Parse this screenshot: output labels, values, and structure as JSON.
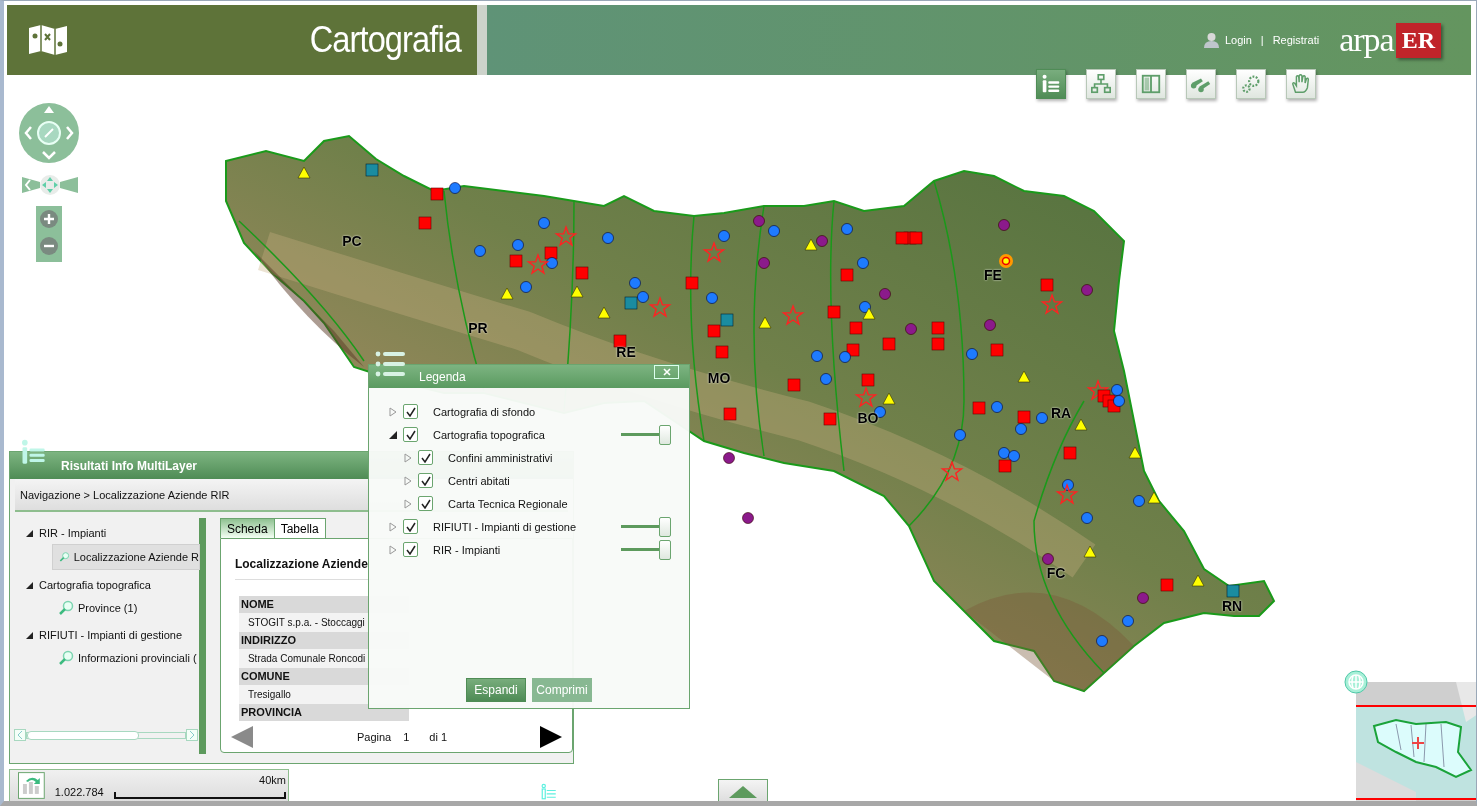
{
  "header": {
    "title": "Cartografia",
    "login": "Login",
    "separator": "|",
    "register": "Registrati",
    "logo": {
      "text": "arpa",
      "badge": "ER"
    }
  },
  "toolbar": [
    {
      "selected": true
    },
    {
      "selected": false
    },
    {
      "selected": false
    },
    {
      "selected": false
    },
    {
      "selected": false
    },
    {
      "selected": false
    }
  ],
  "map": {
    "labels": [
      "PC",
      "PR",
      "RE",
      "MO",
      "BO",
      "FE",
      "RA",
      "FC",
      "RN"
    ]
  },
  "results_panel": {
    "title": "Risultati Info MultiLayer",
    "breadcrumb": "Navigazione > Localizzazione Aziende RIR",
    "tree": [
      {
        "label": "RIR - Impianti",
        "expanded": true,
        "children": [
          {
            "label": "Localizzazione Aziende R",
            "selected": true
          }
        ]
      },
      {
        "label": "Cartografia topografica",
        "expanded": true,
        "children": [
          {
            "label": "Province (1)",
            "selected": false
          }
        ]
      },
      {
        "label": "RIFIUTI - Impianti di gestione",
        "expanded": true,
        "children": [
          {
            "label": "Informazioni provinciali (",
            "selected": false
          }
        ]
      }
    ],
    "tabs": [
      {
        "label": "Scheda",
        "selected": true
      },
      {
        "label": "Tabella",
        "selected": false
      }
    ],
    "heading": "Localizzazione Aziende",
    "fields": [
      {
        "name": "NOME",
        "value": "STOGIT s.p.a. - Stoccaggi"
      },
      {
        "name": "INDIRIZZO",
        "value": "Strada Comunale Roncodi"
      },
      {
        "name": "COMUNE",
        "value": "Tresigallo"
      },
      {
        "name": "PROVINCIA"
      }
    ],
    "pagination": {
      "label": "Pagina",
      "page": "1",
      "total": "di 1",
      "previous_disabled": true,
      "next_disabled": false
    }
  },
  "legend": {
    "title": "Legenda",
    "items": [
      {
        "label": "Cartografia di sfondo",
        "expanded": false,
        "checked": true
      },
      {
        "label": "Cartografia topografica",
        "expanded": true,
        "checked": true,
        "level": 1,
        "children": [
          {
            "label": "Confini amministrativi",
            "expanded": false,
            "checked": true
          },
          {
            "label": "Centri abitati",
            "expanded": false,
            "checked": true
          },
          {
            "label": "Carta Tecnica Regionale",
            "expanded": false,
            "checked": true
          }
        ]
      },
      {
        "label": "RIFIUTI - Impianti di gestione",
        "expanded": false,
        "checked": true,
        "level": 1
      },
      {
        "label": "RIR - Impianti",
        "expanded": false,
        "checked": true,
        "level": 1
      }
    ],
    "buttons": [
      {
        "label": "Espandi",
        "disabled": false
      },
      {
        "label": "Comprimi",
        "disabled": true
      }
    ]
  },
  "scale": {
    "ratio": "1.022.784",
    "distance": "40km"
  }
}
